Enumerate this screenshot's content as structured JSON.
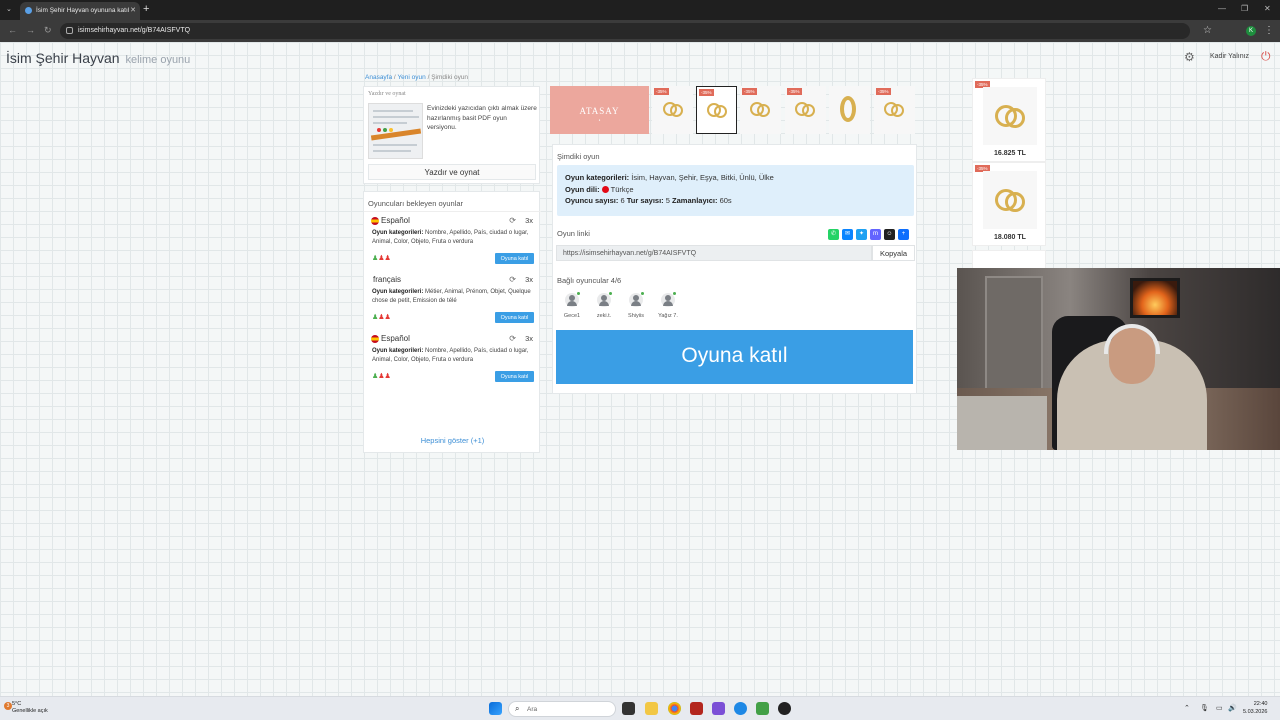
{
  "browser": {
    "tab_title": "İsim Şehir Hayvan oyununa katıl",
    "url": "isimsehirhayvan.net/g/B74AISFVTQ",
    "profile_initial": "K"
  },
  "site": {
    "title": "İsim Şehir Hayvan",
    "subtitle": "kelime oyunu",
    "user_name": "Kadir Yalınız"
  },
  "breadcrumb": {
    "home": "Anasayfa",
    "new_game": "Yeni oyun",
    "current": "Şimdiki oyun",
    "sep": "/"
  },
  "print_card": {
    "title": "Yazdır ve oynat",
    "description": "Evinizdeki yazıcıdan çıktı almak üzere hazırlanmış basit PDF oyun versiyonu.",
    "button": "Yazdır ve oynat"
  },
  "waiting": {
    "title": "Oyuncuları bekleyen oyunlar",
    "category_label": "Oyun kategorileri:",
    "join_label": "Oyuna katıl",
    "show_all": "Hepsini göster (+1)",
    "games": [
      {
        "lang": "Español",
        "rounds": "3x",
        "categories": "Nombre, Apellido, País, ciudad o lugar, Animal, Color, Objeto, Fruta o verdura"
      },
      {
        "lang": "français",
        "rounds": "3x",
        "categories": "Métier, Animal, Prénom, Objet, Quelque chose de petit, Emission de télé"
      },
      {
        "lang": "Español",
        "rounds": "3x",
        "categories": "Nombre, Apellido, País, ciudad o lugar, Animal, Color, Objeto, Fruta o verdura"
      }
    ]
  },
  "ads": {
    "brand": "ATASAY",
    "discount": "-35%",
    "prices": [
      "16.825 TL",
      "18.080 TL"
    ]
  },
  "current_game": {
    "title": "Şimdiki oyun",
    "categories_label": "Oyun kategorileri:",
    "categories": "İsim, Hayvan, Şehir, Eşya, Bitki, Ünlü, Ülke",
    "language_label": "Oyun dili:",
    "language": "Türkçe",
    "players_label": "Oyuncu sayısı:",
    "players": "6",
    "rounds_label": "Tur sayısı:",
    "rounds": "5",
    "timer_label": "Zamanlayıcı:",
    "timer": "60s",
    "link_label": "Oyun linki",
    "link": "https://isimsehirhayvan.net/g/B74AISFVTQ",
    "copy_button": "Kopyala",
    "connected_label": "Bağlı oyuncular 4/6",
    "connected_players": [
      "Gece1",
      "zeki.t.",
      "Shiyiis",
      "Yağız 7."
    ],
    "join_button": "Oyuna katıl"
  },
  "taskbar": {
    "weather_temp": "5°C",
    "weather_desc": "Genellikle açık",
    "weather_badge": "3",
    "search_placeholder": "Ara",
    "time": "22:40",
    "date": "5.03.2026"
  },
  "colors": {
    "primary_button": "#3a9ee5",
    "info_box": "#dfeffb",
    "link": "#3d8fd6",
    "ad_discount_badge": "#e06b5a"
  }
}
